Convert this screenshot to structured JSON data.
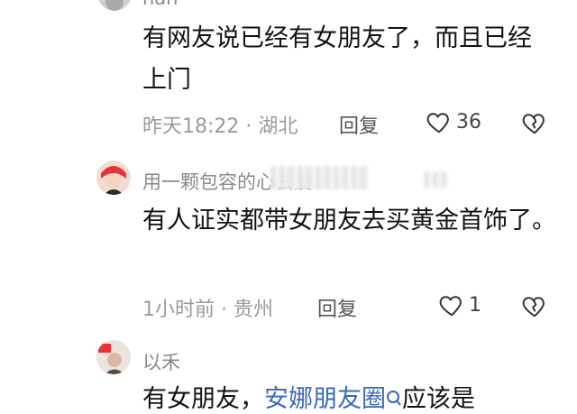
{
  "comments": [
    {
      "username": "nan",
      "text": "有网友说已经有女朋友了，而且已经上门",
      "time": "昨天18:22",
      "location": "湖北",
      "reply_label": "回复",
      "likes": "36"
    },
    {
      "username": "用一颗包容的心去爱",
      "text": "有人证实都带女朋友去买黄金首饰了。",
      "time": "1小时前",
      "location": "贵州",
      "reply_label": "回复",
      "likes": "1"
    },
    {
      "username": "以禾",
      "text_prefix": "有女朋友，",
      "text_link": "安娜朋友圈",
      "text_suffix": "应该是"
    }
  ],
  "separator": "·",
  "icons": {
    "like": "heart-outline-icon",
    "dislike": "broken-heart-icon"
  },
  "colors": {
    "meta": "#9a9a9a",
    "link": "#3a68b8",
    "avatar2_accent": "#e8313a"
  }
}
